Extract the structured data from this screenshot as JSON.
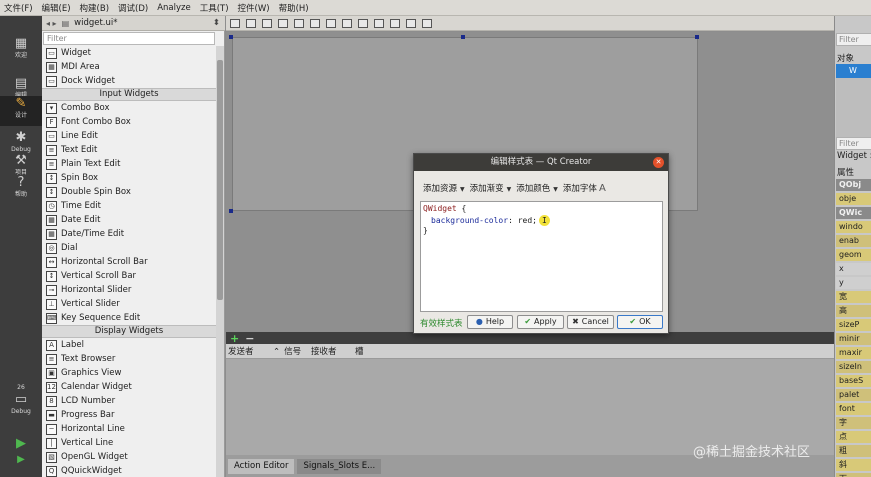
{
  "menubar": {
    "items": [
      "文件(F)",
      "编辑(E)",
      "构建(B)",
      "调试(D)",
      "Analyze",
      "工具(T)",
      "控件(W)",
      "帮助(H)"
    ]
  },
  "modebar": {
    "items": [
      {
        "label": "欢迎",
        "icon": "grid-icon"
      },
      {
        "label": "编辑",
        "icon": "document-icon"
      },
      {
        "label": "设计",
        "icon": "pencil-icon"
      },
      {
        "label": "Debug",
        "icon": "bug-icon"
      },
      {
        "label": "项目",
        "icon": "wrench-icon"
      },
      {
        "label": "帮助",
        "icon": "help-icon"
      }
    ],
    "kit_label": "26",
    "kit_sub": "Debug"
  },
  "editor_tab": {
    "filename": "widget.ui*"
  },
  "widgetbox": {
    "filter_placeholder": "Filter",
    "items": [
      {
        "kind": "item",
        "label": "Widget"
      },
      {
        "kind": "item",
        "label": "MDI Area"
      },
      {
        "kind": "item",
        "label": "Dock Widget"
      },
      {
        "kind": "cat",
        "label": "Input Widgets"
      },
      {
        "kind": "item",
        "label": "Combo Box"
      },
      {
        "kind": "item",
        "label": "Font Combo Box"
      },
      {
        "kind": "item",
        "label": "Line Edit"
      },
      {
        "kind": "item",
        "label": "Text Edit"
      },
      {
        "kind": "item",
        "label": "Plain Text Edit"
      },
      {
        "kind": "item",
        "label": "Spin Box"
      },
      {
        "kind": "item",
        "label": "Double Spin Box"
      },
      {
        "kind": "item",
        "label": "Time Edit"
      },
      {
        "kind": "item",
        "label": "Date Edit"
      },
      {
        "kind": "item",
        "label": "Date/Time Edit"
      },
      {
        "kind": "item",
        "label": "Dial"
      },
      {
        "kind": "item",
        "label": "Horizontal Scroll Bar"
      },
      {
        "kind": "item",
        "label": "Vertical Scroll Bar"
      },
      {
        "kind": "item",
        "label": "Horizontal Slider"
      },
      {
        "kind": "item",
        "label": "Vertical Slider"
      },
      {
        "kind": "item",
        "label": "Key Sequence Edit"
      },
      {
        "kind": "cat",
        "label": "Display Widgets"
      },
      {
        "kind": "item",
        "label": "Label"
      },
      {
        "kind": "item",
        "label": "Text Browser"
      },
      {
        "kind": "item",
        "label": "Graphics View"
      },
      {
        "kind": "item",
        "label": "Calendar Widget"
      },
      {
        "kind": "item",
        "label": "LCD Number"
      },
      {
        "kind": "item",
        "label": "Progress Bar"
      },
      {
        "kind": "item",
        "label": "Horizontal Line"
      },
      {
        "kind": "item",
        "label": "Vertical Line"
      },
      {
        "kind": "item",
        "label": "OpenGL Widget"
      },
      {
        "kind": "item",
        "label": "QQuickWidget"
      }
    ]
  },
  "action_editor": {
    "columns": [
      "发送者",
      "信号",
      "接收者",
      "槽"
    ],
    "tabs": [
      "Action Editor",
      "Signals_Slots E..."
    ]
  },
  "object_inspector": {
    "filter_placeholder": "Filter",
    "header": "对象",
    "selected": "W"
  },
  "property_editor": {
    "filter_placeholder": "Filter",
    "title": "Widget :",
    "header": "属性",
    "rows": [
      "QObj",
      "obje",
      "QWic",
      "windo",
      "enab",
      "geom",
      "x",
      "y",
      "宽",
      "高",
      "sizeP",
      "minir",
      "maxir",
      "sizeIn",
      "baseS",
      "palet",
      "font",
      "字",
      "点",
      "粗",
      "斜",
      "下"
    ]
  },
  "dialog": {
    "title": "编辑样式表 — Qt Creator",
    "menu": [
      "添加资源",
      "添加渐变",
      "添加颜色",
      "添加字体"
    ],
    "code": {
      "line1_selector": "QWidget",
      "line1_brace": " {",
      "line2_prop": "background-color",
      "line2_value": ": red;",
      "line3": "}"
    },
    "status": "有效样式表",
    "buttons": {
      "help": "Help",
      "apply": "Apply",
      "cancel": "Cancel",
      "ok": "OK"
    }
  },
  "watermark": "@稀土掘金技术社区",
  "colors": {
    "accent": "#2a7fd0",
    "dialog_title": "#3d3c39",
    "valid_green": "#2e8a2e"
  }
}
